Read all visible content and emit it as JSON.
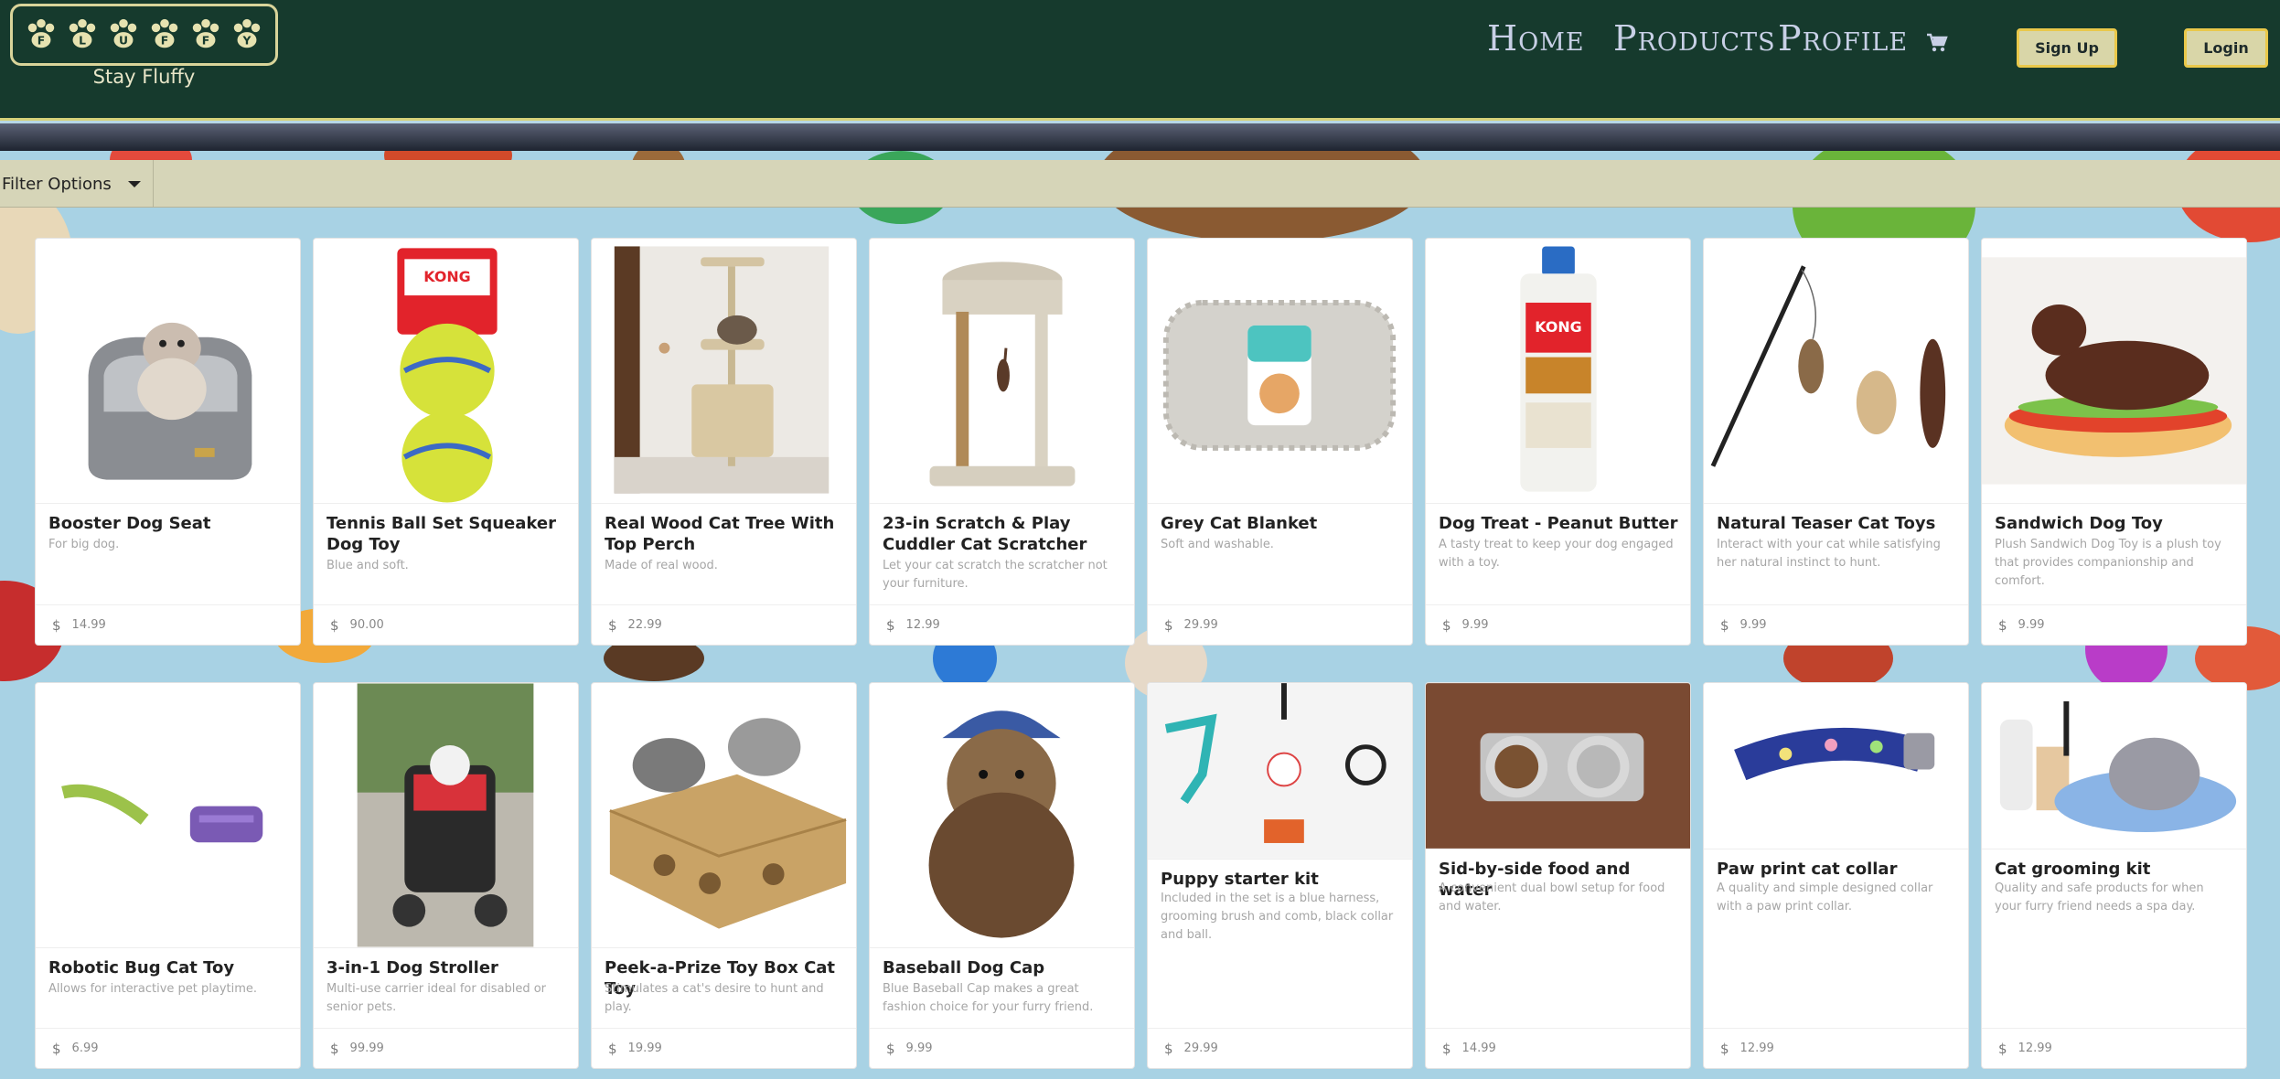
{
  "header": {
    "tagline": "Stay Fluffy",
    "logo_letters": [
      "F",
      "L",
      "U",
      "F",
      "F",
      "Y"
    ],
    "nav": {
      "home": "Home",
      "products": "Products",
      "profile": "Profile"
    },
    "cart_icon": "shopping-cart-icon",
    "signup_label": "Sign Up",
    "login_label": "Login"
  },
  "filter": {
    "label": "Filter Options"
  },
  "products": [
    {
      "name": "Booster Dog Seat",
      "desc": "For big dog.",
      "currency": "$",
      "price": "14.99"
    },
    {
      "name": "Tennis Ball Set Squeaker Dog Toy",
      "desc": "Blue and soft.",
      "currency": "$",
      "price": "90.00"
    },
    {
      "name": "Real Wood Cat Tree With Top Perch",
      "desc": "Made of real wood.",
      "currency": "$",
      "price": "22.99"
    },
    {
      "name": "23-in Scratch & Play Cuddler Cat Scratcher",
      "desc": "Let your cat scratch the scratcher not your furniture.",
      "currency": "$",
      "price": "12.99"
    },
    {
      "name": "Grey Cat Blanket",
      "desc": "Soft and washable.",
      "currency": "$",
      "price": "29.99"
    },
    {
      "name": "Dog Treat - Peanut Butter",
      "desc": "A tasty treat to keep your dog engaged with a toy.",
      "currency": "$",
      "price": "9.99"
    },
    {
      "name": "Natural Teaser Cat Toys",
      "desc": "Interact with your cat while satisfying her natural instinct to hunt.",
      "currency": "$",
      "price": "9.99"
    },
    {
      "name": "Sandwich Dog Toy",
      "desc": "Plush Sandwich Dog Toy is a plush toy that provides companionship and comfort.",
      "currency": "$",
      "price": "9.99"
    },
    {
      "name": "Robotic Bug Cat Toy",
      "desc": "Allows for interactive pet playtime.",
      "currency": "$",
      "price": "6.99"
    },
    {
      "name": "3-in-1 Dog Stroller",
      "desc": "Multi-use carrier ideal for disabled or senior pets.",
      "currency": "$",
      "price": "99.99"
    },
    {
      "name": "Peek-a-Prize Toy Box Cat Toy",
      "desc": "Stimulates a cat's desire to hunt and play.",
      "currency": "$",
      "price": "19.99"
    },
    {
      "name": "Baseball Dog Cap",
      "desc": "Blue Baseball Cap makes a great fashion choice for your furry friend.",
      "currency": "$",
      "price": "9.99"
    },
    {
      "name": "Puppy starter kit",
      "desc": "Included in the set is a blue harness, grooming brush and comb, black collar and ball.",
      "currency": "$",
      "price": "29.99"
    },
    {
      "name": "Sid-by-side food and water",
      "desc": "A convenient dual bowl setup for food and water.",
      "currency": "$",
      "price": "14.99"
    },
    {
      "name": "Paw print cat collar",
      "desc": "A quality and simple designed collar with a paw print collar.",
      "currency": "$",
      "price": "12.99"
    },
    {
      "name": "Cat grooming kit",
      "desc": "Quality and safe products for when your furry friend needs a spa day.",
      "currency": "$",
      "price": "12.99"
    }
  ],
  "colors": {
    "header_bg": "#163a2d",
    "accent": "#d6d27a",
    "filter_bg": "#d6d5b8",
    "button_bg": "#d9d6a8"
  }
}
